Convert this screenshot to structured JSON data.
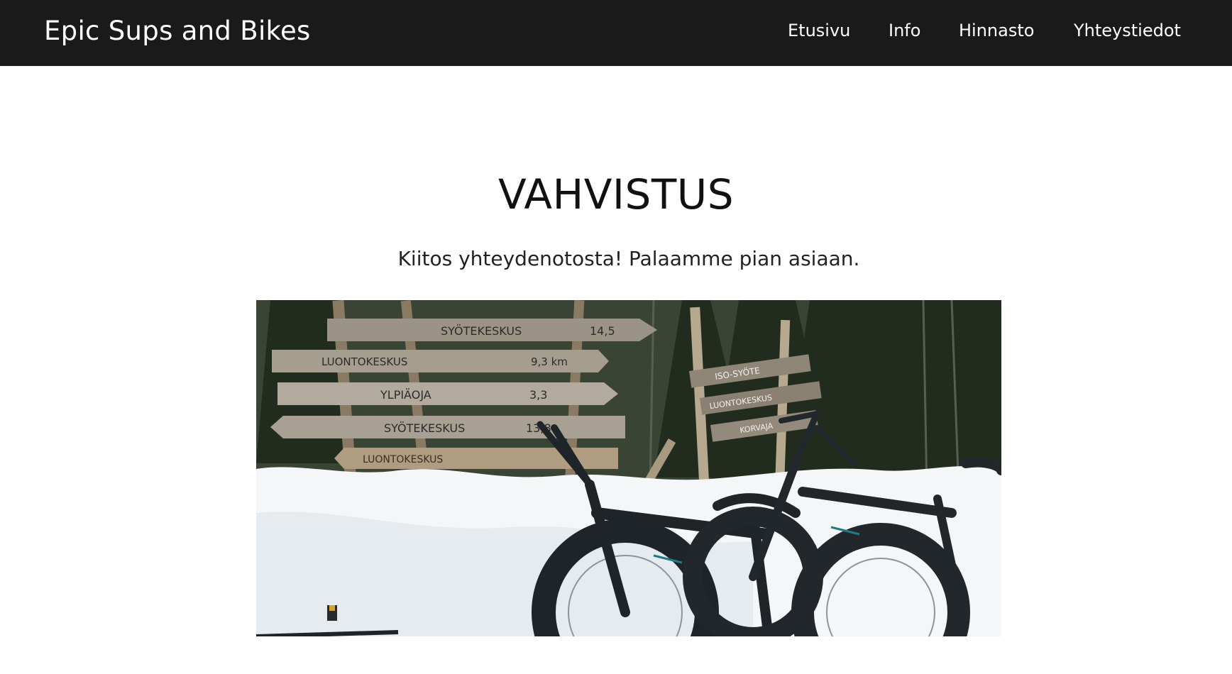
{
  "header": {
    "brand": "Epic Sups and Bikes",
    "nav": [
      "Etusivu",
      "Info",
      "Hinnasto",
      "Yhteystiedot"
    ]
  },
  "main": {
    "title": "VAHVISTUS",
    "message": "Kiitos yhteydenotosta! Palaamme pian asiaan."
  },
  "photo": {
    "signs_left": [
      {
        "place": "SYÖTEKESKUS",
        "distance": "14,5"
      },
      {
        "place": "LUONTOKESKUS",
        "distance": "9,3 km"
      },
      {
        "place": "YLPIÄOJA",
        "distance": "3,3"
      },
      {
        "place": "SYÖTEKESKUS",
        "distance": "13,8"
      },
      {
        "place": "LUONTOKESKUS",
        "distance": ""
      }
    ],
    "signs_right": [
      "ISO-SYÖTE",
      "LUONTOKESKUS",
      "KORVAJA"
    ]
  },
  "colors": {
    "navbar": "#1b1a1a",
    "nav_text": "#ffffff",
    "title_text": "#111111"
  }
}
